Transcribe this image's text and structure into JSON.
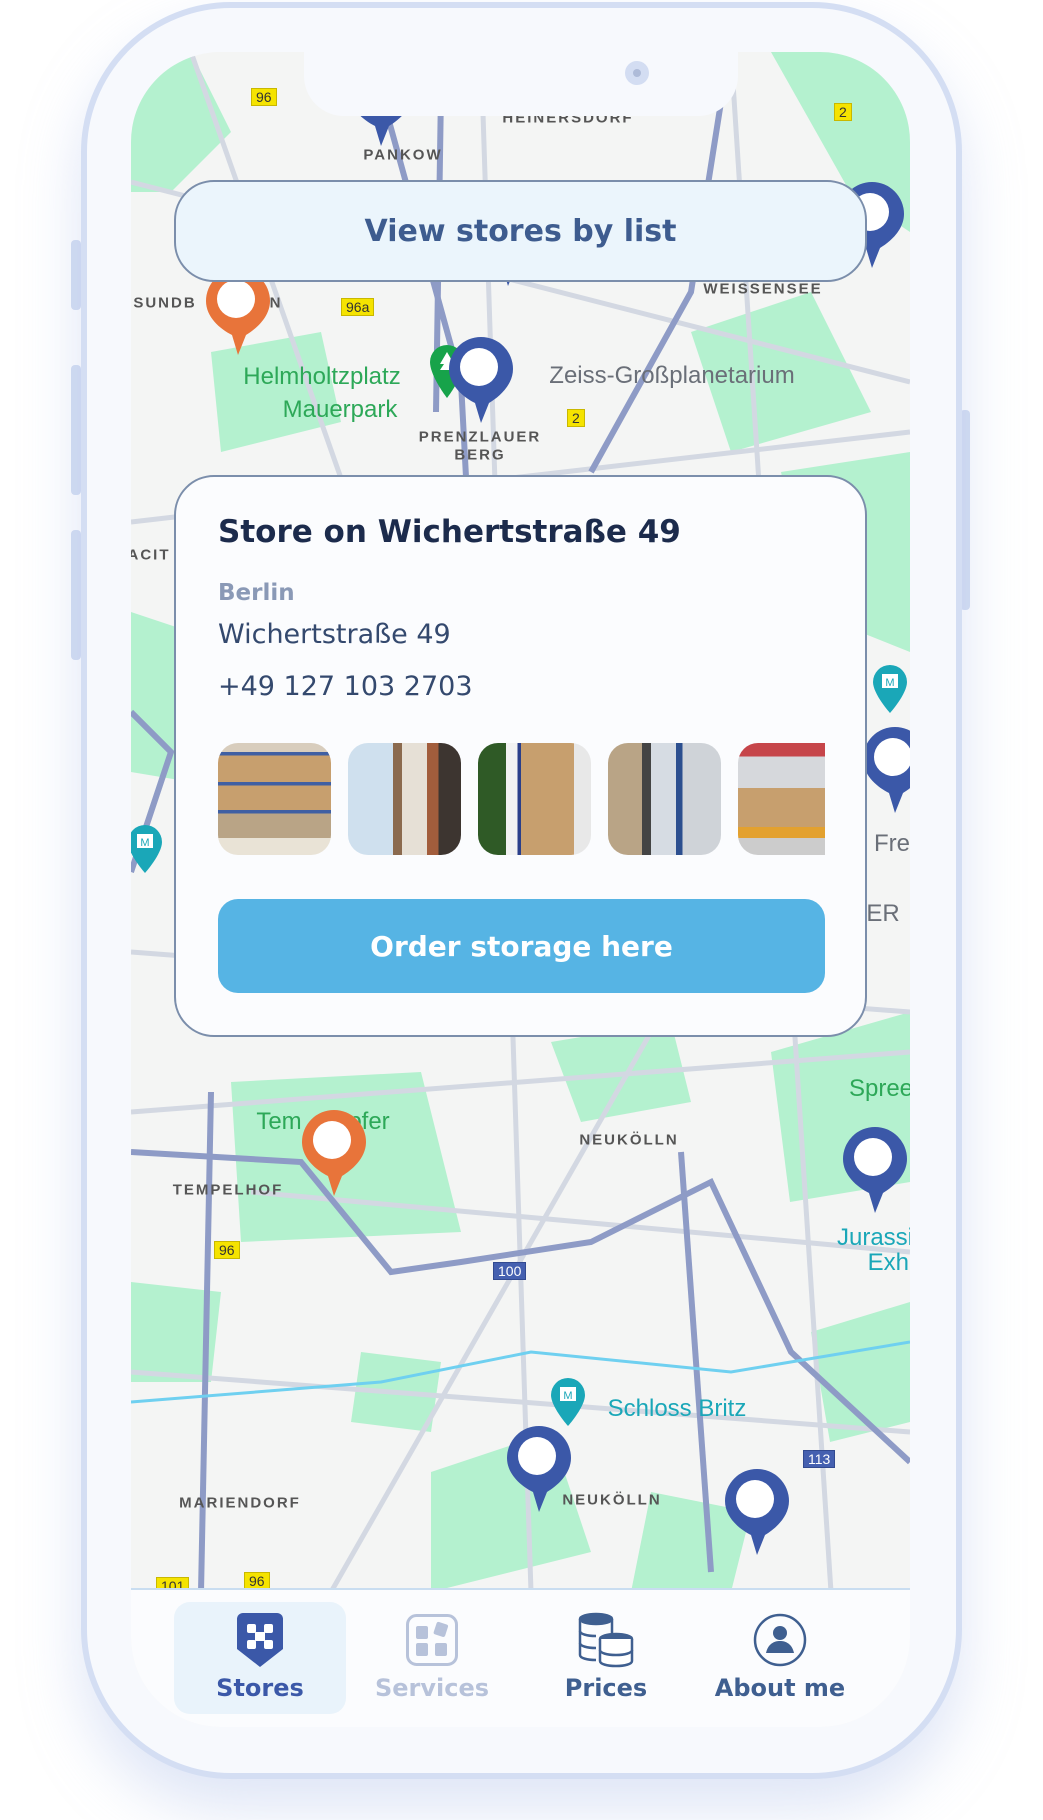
{
  "map": {
    "districts": [
      "PANKOW",
      "HEINERSDORF",
      "WEISSENSEE",
      "PRENZLAUER",
      "BERG",
      "NEUKÖLLN",
      "TEMPELHOF",
      "MARIENDORF",
      "NEUKÖLLN",
      "ESUNDB",
      "N",
      "ACIT"
    ],
    "parks": [
      "Helmholtzplatz",
      "Mauerpark",
      "Tem",
      "pfer",
      "Spree"
    ],
    "pois": [
      "Zeiss-Großplanetarium",
      "Fre",
      "ER"
    ],
    "museums": [
      "Schloss Britz",
      "Jurassic",
      "Exhi"
    ],
    "roads": [
      "96",
      "96a",
      "2",
      "2",
      "100",
      "113",
      "96",
      "101"
    ],
    "colors": {
      "store_pin": "#3b58a8",
      "selected_pin": "#e8743a",
      "museum_pin": "#1aa7b8",
      "park": "#b4f1cf"
    }
  },
  "list_button": {
    "label": "View stores by list"
  },
  "store_card": {
    "title": "Store on Wichertstraße 49",
    "city": "Berlin",
    "address": "Wichertstraße 49",
    "phone": "+49 127 103 2703",
    "photos": [
      "warehouse-shelves",
      "storage-room-window",
      "office-storage-shelf",
      "warehouse-worker",
      "warehouse-forklift"
    ],
    "order_button": "Order storage here",
    "accent": "#56b4e4"
  },
  "nav": {
    "tabs": [
      {
        "label": "Stores",
        "icon": "store-shield-icon",
        "active": true
      },
      {
        "label": "Services",
        "icon": "services-grid-icon",
        "active": false
      },
      {
        "label": "Prices",
        "icon": "coins-stack-icon",
        "active": false
      },
      {
        "label": "About me",
        "icon": "user-circle-icon",
        "active": false
      }
    ]
  }
}
